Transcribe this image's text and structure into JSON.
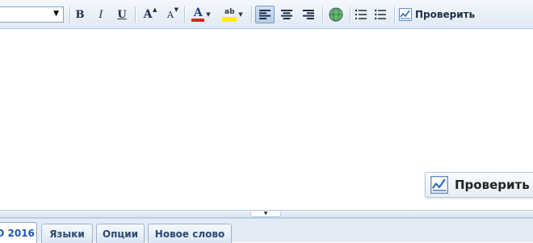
{
  "toolbar": {
    "font_value": "",
    "bold_label": "B",
    "italic_label": "I",
    "underline_label": "U",
    "grow_font_label": "A",
    "shrink_font_label": "A",
    "font_color_label": "A",
    "highlight_label": "ab",
    "check_label": "Проверить"
  },
  "editor": {
    "text": "",
    "floating_check_label": "Проверить"
  },
  "tabs": [
    {
      "label": "О 2016",
      "selected": true
    },
    {
      "label": "Языки",
      "selected": false
    },
    {
      "label": "Опции",
      "selected": false
    },
    {
      "label": "Новое слово",
      "selected": false
    }
  ],
  "colors": {
    "font_color_bar": "#e02020",
    "highlight_bar": "#ffee00",
    "tab_selected_text": "#1f56b5",
    "tab_text": "#2d4a72"
  },
  "icons": [
    "dropdown-arrow-icon",
    "grow-font-icon",
    "shrink-font-icon",
    "font-color-icon",
    "highlight-icon",
    "align-left-icon",
    "align-center-icon",
    "align-right-icon",
    "globe-icon",
    "numbered-list-icon",
    "bullet-list-icon",
    "spellcheck-icon",
    "resize-grip-icon"
  ]
}
